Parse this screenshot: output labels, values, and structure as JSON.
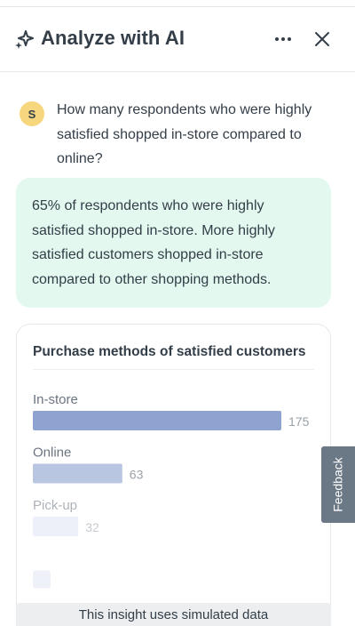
{
  "header": {
    "title": "Analyze with AI",
    "icons": [
      "sparkle-icon",
      "more-icon",
      "close-icon"
    ]
  },
  "conversation": {
    "user_initial": "S",
    "question": "How many respondents who were highly satisfied shopped in-store compared to online?",
    "answer": "65% of respondents who were highly satisfied shopped in-store. More highly satisfied customers shopped in-store compared to other shopping methods."
  },
  "chart_data": {
    "type": "bar",
    "orientation": "horizontal",
    "title": "Purchase methods of satisfied customers",
    "categories": [
      "In-store",
      "Online",
      "Pick-up"
    ],
    "values": [
      175,
      63,
      32
    ],
    "colors": [
      "#8ea3cf",
      "#b9c6e2",
      "#dfe5f3"
    ],
    "xlim": [
      0,
      175
    ],
    "grid": false,
    "legend": "none"
  },
  "feedback_tab": {
    "label": "Feedback"
  },
  "footer": {
    "note": "This insight uses simulated data"
  },
  "colors": {
    "answer_bg": "#e3f8ef",
    "avatar_bg": "#f7d77e",
    "feedback_bg": "#6b7886"
  }
}
